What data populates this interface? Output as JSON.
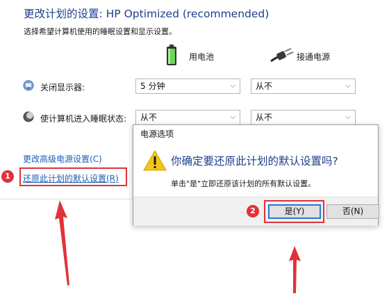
{
  "header": {
    "title": "更改计划的设置: HP Optimized (recommended)",
    "subtitle": "选择希望计算机使用的睡眠设置和显示设置。"
  },
  "columns": {
    "battery_label": "用电池",
    "plugged_label": "接通电源"
  },
  "rows": [
    {
      "label": "关闭显示器:",
      "battery_value": "5 分钟",
      "plugged_value": "从不",
      "icon": "monitor-icon"
    },
    {
      "label": "使计算机进入睡眠状态:",
      "battery_value": "从不",
      "plugged_value": "从不",
      "icon": "moon-icon"
    }
  ],
  "links": {
    "advanced": "更改高级电源设置(C)",
    "restore": "还原此计划的默认设置(R)"
  },
  "dialog": {
    "title": "电源选项",
    "question": "你确定要还原此计划的默认设置吗?",
    "message": "单击\"是\"立即还原该计划的所有默认设置。",
    "yes_label": "是(Y)",
    "no_label": "否(N)",
    "icon": "warning-icon"
  },
  "annotations": {
    "badge_1": "1",
    "badge_2": "2",
    "accent_color": "#e0323a"
  }
}
